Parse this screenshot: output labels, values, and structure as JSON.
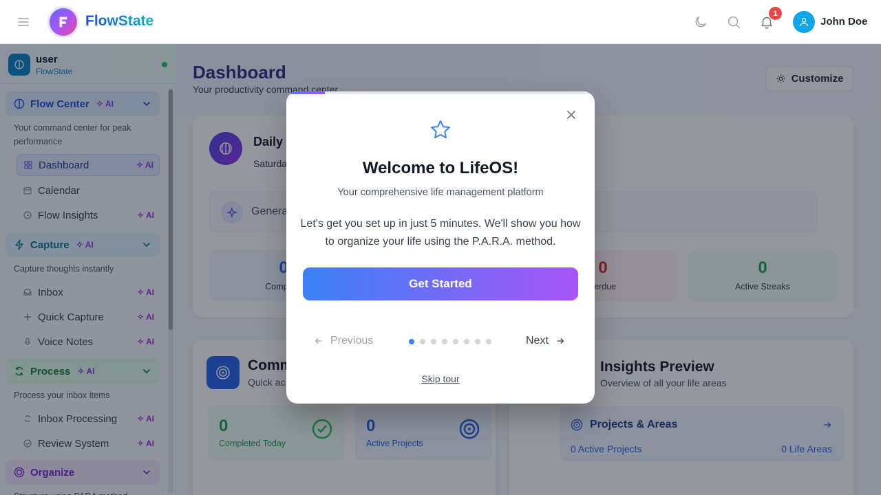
{
  "header": {
    "brand": "FlowState",
    "notification_count": "1",
    "user_name": "John Doe"
  },
  "sidebar": {
    "user": {
      "name": "user",
      "subtitle": "FlowState"
    },
    "ai_label": "AI",
    "sections": [
      {
        "title": "Flow Center",
        "description": "Your command center for peak performance",
        "items": [
          {
            "label": "Dashboard"
          },
          {
            "label": "Calendar"
          },
          {
            "label": "Flow Insights"
          }
        ]
      },
      {
        "title": "Capture",
        "description": "Capture thoughts instantly",
        "items": [
          {
            "label": "Inbox"
          },
          {
            "label": "Quick Capture"
          },
          {
            "label": "Voice Notes"
          }
        ]
      },
      {
        "title": "Process",
        "description": "Process your inbox items",
        "items": [
          {
            "label": "Inbox Processing"
          },
          {
            "label": "Review System"
          }
        ]
      },
      {
        "title": "Organize",
        "description": "Structure using PARA method"
      }
    ]
  },
  "main": {
    "title": "Dashboard",
    "subtitle": "Your productivity command center",
    "customize_label": "Customize",
    "daily": {
      "title": "Daily",
      "date": "Saturday"
    },
    "generate_label": "Genera",
    "stats": [
      {
        "value": "0",
        "label": "Complete",
        "color": "#2563eb"
      },
      {
        "value": "0",
        "label": "verdue",
        "color": "#dc2626"
      },
      {
        "value": "0",
        "label": "Active Streaks",
        "color": "#16a34a"
      }
    ],
    "command": {
      "title": "Comm",
      "subtitle": "Quick ac"
    },
    "mini_stats": [
      {
        "value": "0",
        "label": "Completed Today",
        "color": "#16a34a"
      },
      {
        "value": "0",
        "label": "Active Projects",
        "color": "#2563eb"
      }
    ],
    "insights": {
      "title": "Insights Preview",
      "subtitle": "Overview of all your life areas"
    },
    "projects": {
      "title": "Projects & Areas",
      "active_projects": "0 Active Projects",
      "life_areas": "0 Life Areas"
    }
  },
  "modal": {
    "title": "Welcome to LifeOS!",
    "subtitle": "Your comprehensive life management platform",
    "body": "Let's get you set up in just 5 minutes. We'll show you how to organize your life using the P.A.R.A. method.",
    "primary_button": "Get Started",
    "prev_label": "Previous",
    "next_label": "Next",
    "skip_label": "Skip tour",
    "current_step": 1,
    "total_steps": 8
  },
  "colors": {
    "accent_blue": "#3b82f6",
    "accent_purple": "#a855f7",
    "badge_red": "#ef4444"
  }
}
